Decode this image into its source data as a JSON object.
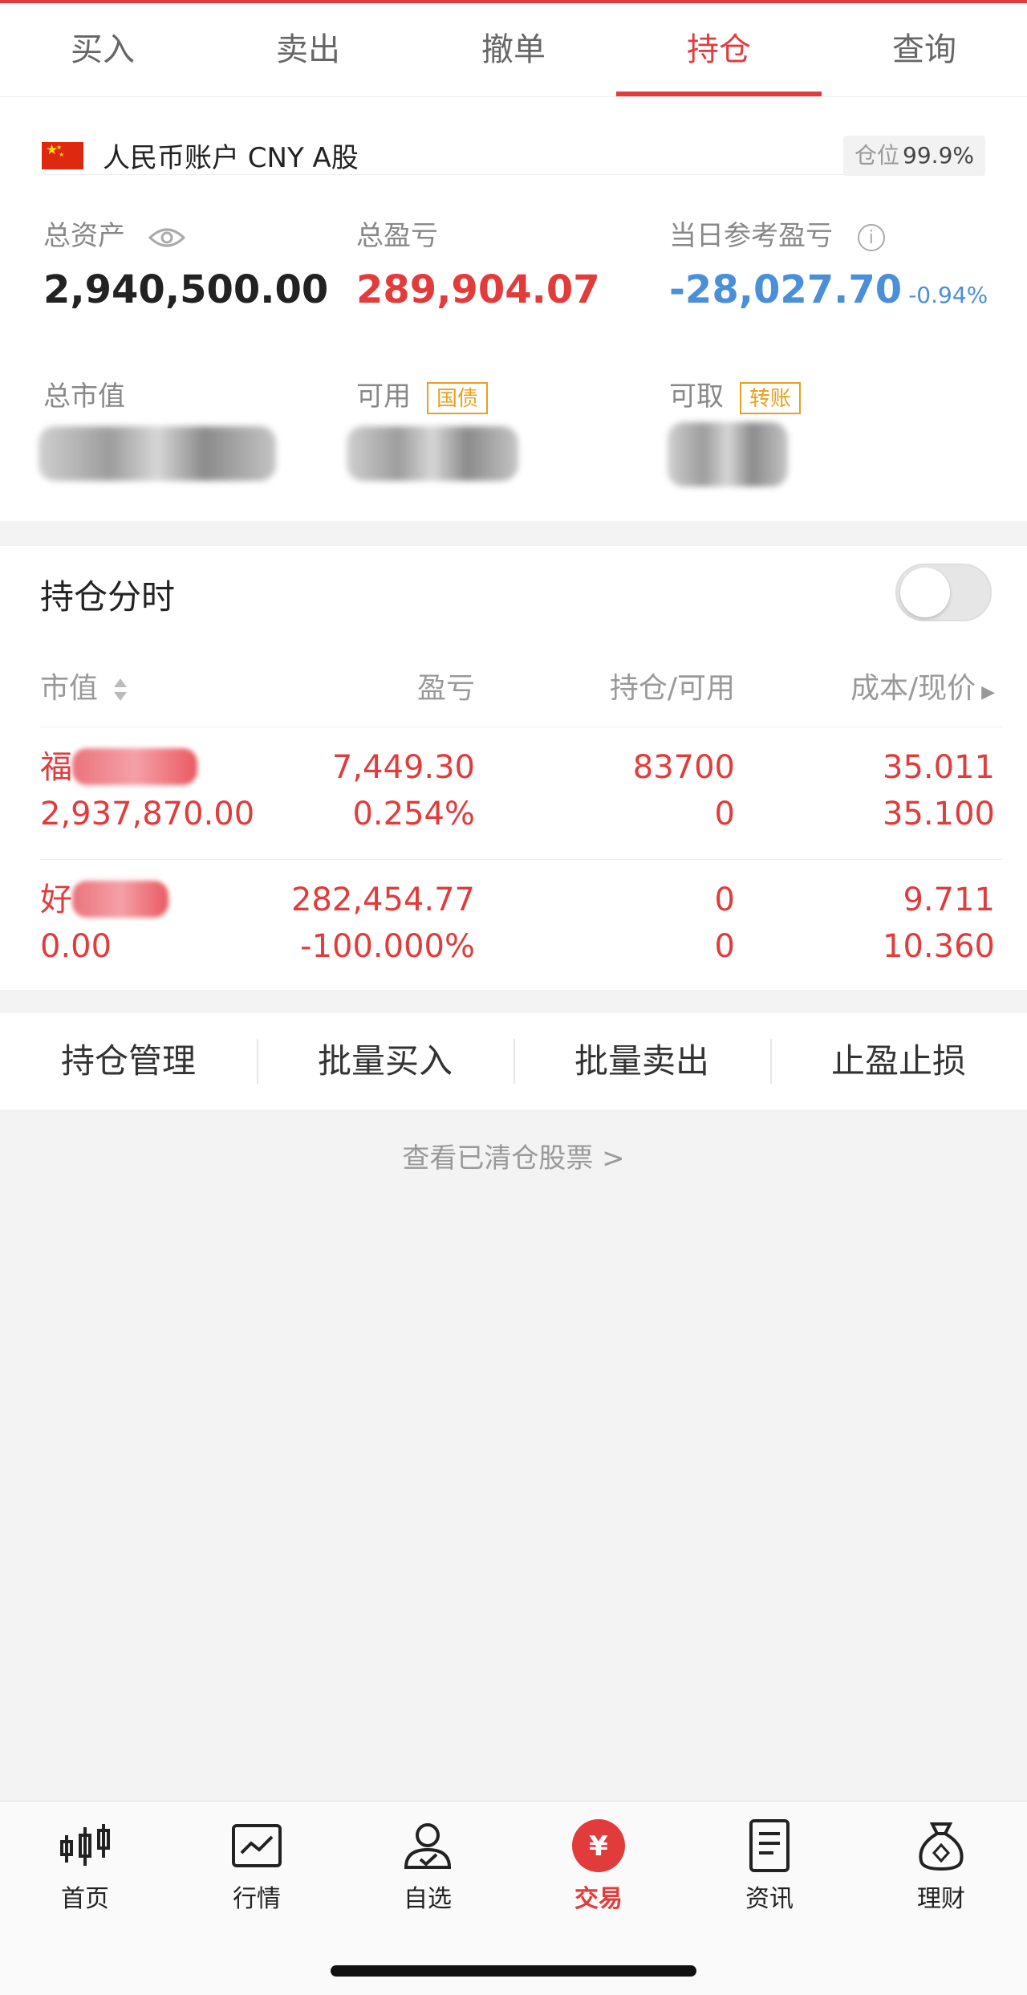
{
  "tabs": [
    "买入",
    "卖出",
    "撤单",
    "持仓",
    "查询"
  ],
  "active_tab": "持仓",
  "account": {
    "name": "人民币账户 CNY A股",
    "position_label": "仓位",
    "position_value": "99.9%"
  },
  "stats": {
    "total_assets_label": "总资产",
    "total_assets": "2,940,500.00",
    "total_pl_label": "总盈亏",
    "total_pl": "289,904.07",
    "daily_pl_label": "当日参考盈亏",
    "daily_pl": "-28,027.70",
    "daily_pl_pct": "-0.94%",
    "market_value_label": "总市值",
    "available_label": "可用",
    "available_tag": "国债",
    "withdrawable_label": "可取",
    "withdrawable_tag": "转账"
  },
  "holdings_section": {
    "title": "持仓分时",
    "headers": [
      "市值",
      "盈亏",
      "持仓/可用",
      "成本/现价"
    ],
    "rows": [
      {
        "name_prefix": "福",
        "market_value": "2,937,870.00",
        "pl": "7,449.30",
        "pl_pct": "0.254%",
        "hold": "83700",
        "avail": "0",
        "cost": "35.011",
        "price": "35.100"
      },
      {
        "name_prefix": "好",
        "market_value": "0.00",
        "pl": "282,454.77",
        "pl_pct": "-100.000%",
        "hold": "0",
        "avail": "0",
        "cost": "9.711",
        "price": "10.360"
      }
    ]
  },
  "actions": [
    "持仓管理",
    "批量买入",
    "批量卖出",
    "止盈止损"
  ],
  "cleared_link": "查看已清仓股票 >",
  "bottom_nav": [
    {
      "label": "首页",
      "icon": "candlestick-icon"
    },
    {
      "label": "行情",
      "icon": "chart-icon"
    },
    {
      "label": "自选",
      "icon": "user-check-icon"
    },
    {
      "label": "交易",
      "icon": "yen-icon"
    },
    {
      "label": "资讯",
      "icon": "document-icon"
    },
    {
      "label": "理财",
      "icon": "money-bag-icon"
    }
  ],
  "active_nav": "交易",
  "colors": {
    "accent": "#e23b3b",
    "negative": "#4a8fd8",
    "tag": "#e8a01f"
  }
}
